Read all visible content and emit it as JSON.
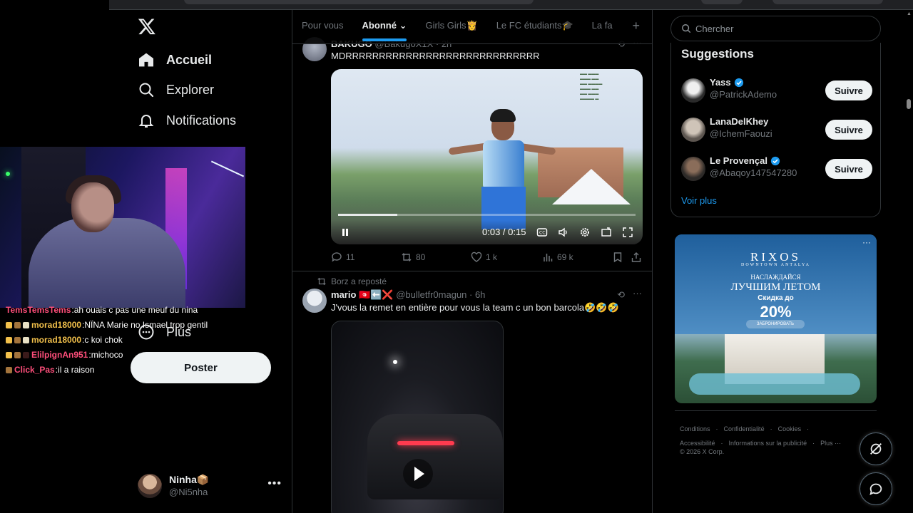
{
  "nav": {
    "items": [
      {
        "label": "Accueil",
        "icon": "home-icon"
      },
      {
        "label": "Explorer",
        "icon": "search-icon"
      },
      {
        "label": "Notifications",
        "icon": "bell-icon"
      },
      {
        "label": "Plus",
        "icon": "more-circle-icon"
      }
    ],
    "post_label": "Poster",
    "account": {
      "name": "Ninha📦",
      "handle": "@Ni5nha"
    }
  },
  "stream_chat": [
    {
      "user": "TemsTemsTems",
      "message": "ah ouais c pas une meuf du nina",
      "color": "#ff4f7b"
    },
    {
      "user": "morad18000",
      "message": "NÏNA Marie no Ismael trop gentil",
      "color": "#f3c14b"
    },
    {
      "user": "morad18000",
      "message": "c koi chok",
      "color": "#f3c14b"
    },
    {
      "user": "ElilpignAn951",
      "message": "michoco",
      "color": "#ff4f7b"
    },
    {
      "user": "Click_Pas",
      "message": "il a raison",
      "color": "#ff4f7b"
    }
  ],
  "feed": {
    "tabs": [
      "Pour vous",
      "Abonné",
      "Girls Girls👸",
      "Le FC étudiants🎓",
      "La fa"
    ],
    "active_tab": "Abonné",
    "tweet1": {
      "name": "BAKUGO",
      "handle": "@BakugoX1X · 2h",
      "text": "MDRRRRRRRRRRRRRRRRRRRRRRRRRRRRR",
      "video_time": "0:03 / 0:15",
      "video_progress": 0.2,
      "replies": "11",
      "reposts": "80",
      "likes": "1 k",
      "views": "69 k"
    },
    "tweet2": {
      "reposted_by": "Borz a reposté",
      "name": "mario 🇹🇳⬅️❌",
      "handle": "@bulletfr0magun · 6h",
      "text": "J'vous la remet en entière pour vous la team c un bon barcola🤣🤣🤣"
    }
  },
  "right": {
    "search_placeholder": "Chercher",
    "suggestions_title": "Suggestions",
    "suggestions": [
      {
        "name": "Yass",
        "handle": "@PatrickAdemo",
        "verified": true,
        "button": "Suivre"
      },
      {
        "name": "LanaDelKhey",
        "handle": "@IchemFaouzi",
        "verified": false,
        "button": "Suivre"
      },
      {
        "name": "Le Provençal",
        "handle": "@Abaqoy147547280",
        "verified": true,
        "button": "Suivre"
      }
    ],
    "see_more": "Voir plus",
    "ad": {
      "brand": "RIXOS",
      "sub": "DOWNTOWN ANTALYA",
      "line1": "НАСЛАЖДАЙСЯ",
      "line2": "ЛУЧШИМ ЛЕТОМ",
      "line3": "Скидка до",
      "percent": "20%",
      "cta": "ЗАБРОНИРОВАТЬ"
    },
    "footer": [
      "Conditions",
      "·",
      "Confidentialité",
      "·",
      "Cookies",
      "·",
      "Accessibilité",
      "·",
      "Informations sur la publicité",
      "·",
      "Plus ···",
      "© 2026 X Corp."
    ]
  },
  "colors": {
    "accent": "#1d9bf0",
    "background": "#000000",
    "border": "#2f3336",
    "muted": "#71767b"
  }
}
